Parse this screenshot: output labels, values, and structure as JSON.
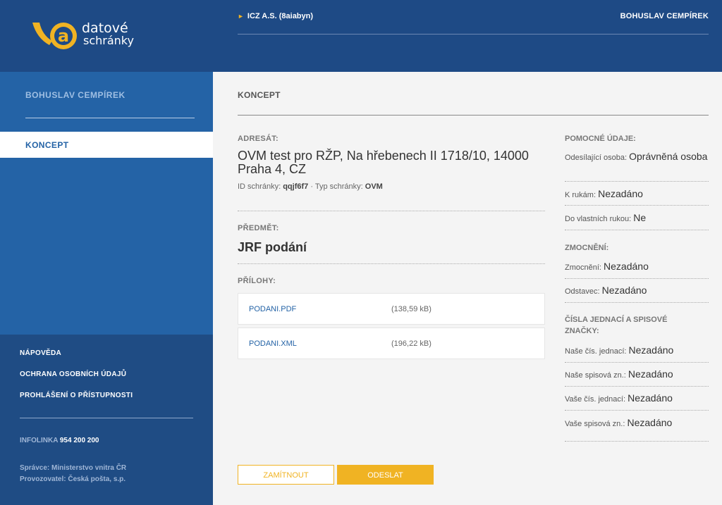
{
  "header": {
    "logo_line1": "datové",
    "logo_line2": "schránky",
    "org": "ICZ A.S. (8aiabyn)",
    "user": "BOHUSLAV CEMPÍREK"
  },
  "sidebar": {
    "user": "BOHUSLAV CEMPÍREK",
    "active_item": "KONCEPT",
    "links": [
      "NÁPOVĚDA",
      "OCHRANA OSOBNÍCH ÚDAJŮ",
      "PROHLÁŠENÍ O PŘÍSTUPNOSTI"
    ],
    "infolinka_label": "INFOLINKA",
    "infolinka_number": "954 200 200",
    "spravce": "Správce: Ministerstvo vnitra ČR",
    "provozovatel": "Provozovatel: Česká pošta, s.p."
  },
  "main": {
    "title": "KONCEPT",
    "adresat_label": "ADRESÁT:",
    "adresat": "OVM test pro RŽP, Na hřebenech II 1718/10, 14000 Praha 4, CZ",
    "id_label": "ID schránky:",
    "id_value": "qqjf6f7",
    "typ_label": "· Typ schránky:",
    "typ_value": "OVM",
    "predmet_label": "PŘEDMĚT:",
    "predmet": "JRF podání",
    "prilohy_label": "PŘÍLOHY:",
    "attachments": [
      {
        "name": "PODANI.PDF",
        "size": "(138,59 kB)"
      },
      {
        "name": "PODANI.XML",
        "size": "(196,22 kB)"
      }
    ],
    "buttons": {
      "reject": "ZAMÍTNOUT",
      "send": "ODESLAT"
    }
  },
  "right": {
    "pomocne_label": "POMOCNÉ ÚDAJE:",
    "odesilajici_label": "Odesílající osoba:",
    "odesilajici_value": "Oprávněná osoba",
    "k_rukam_label": "K rukám:",
    "k_rukam_value": "Nezadáno",
    "do_vlastnich_label": "Do vlastních rukou:",
    "do_vlastnich_value": "Ne",
    "zmocneni_label": "ZMOCNĚNÍ:",
    "zmocneni_field_label": "Zmocnění:",
    "zmocneni_value": "Nezadáno",
    "odstavec_label": "Odstavec:",
    "odstavec_value": "Nezadáno",
    "cisla_label": "ČÍSLA JEDNACÍ A SPISOVÉ ZNAČKY:",
    "nase_cj_label": "Naše čís. jednací:",
    "nase_cj_value": "Nezadáno",
    "nase_sz_label": "Naše spisová zn.:",
    "nase_sz_value": "Nezadáno",
    "vase_cj_label": "Vaše čís. jednací:",
    "vase_cj_value": "Nezadáno",
    "vase_sz_label": "Vaše spisová zn.:",
    "vase_sz_value": "Nezadáno"
  },
  "colors": {
    "header": "#1e4a85",
    "sidebar": "#2463a6",
    "accent": "#f0b323"
  }
}
